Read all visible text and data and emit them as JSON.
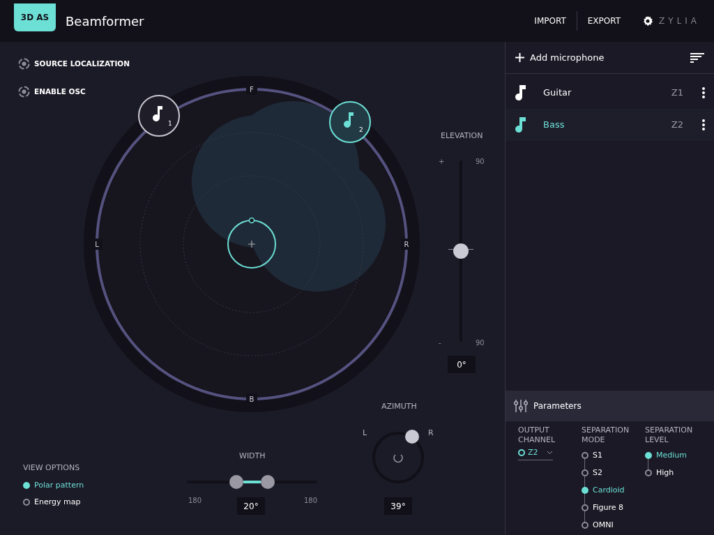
{
  "header": {
    "badge": "3D AS",
    "title": "Beamformer",
    "menu": [
      "IMPORT",
      "EXPORT"
    ],
    "logo": "ZYLIA"
  },
  "toggles": [
    {
      "label": "SOURCE LOCALIZATION"
    },
    {
      "label": "ENABLE OSC"
    }
  ],
  "sound_field": {
    "directions": [
      "F",
      "L",
      "R",
      "B"
    ],
    "sources": [
      {
        "number": "1",
        "selected": false
      },
      {
        "number": "2",
        "selected": true
      }
    ]
  },
  "elevation": {
    "title": "ELEVATION",
    "plus": "+",
    "minus": "-",
    "max": "90",
    "min": "90",
    "level": 0.5,
    "value": "0°"
  },
  "width": {
    "title": "WIDTH",
    "min": "180",
    "max": "180",
    "level": 0.13,
    "value": "20°"
  },
  "azimuth": {
    "title": "AZIMUTH",
    "left": "L",
    "right": "R",
    "value": "39°"
  },
  "view_options": {
    "title": "VIEW OPTIONS",
    "items": [
      {
        "label": "Polar pattern",
        "selected": true
      },
      {
        "label": "Energy map",
        "selected": false
      }
    ]
  },
  "microphones": {
    "add": "Add microphone",
    "items": [
      {
        "name": "Guitar",
        "channel": "Z1",
        "selected": false
      },
      {
        "name": "Bass",
        "channel": "Z2",
        "selected": true
      }
    ]
  },
  "parameters": {
    "title": "Parameters",
    "output_channel": {
      "label": "OUTPUT CHANNEL",
      "value": "Z2"
    },
    "separation_mode": {
      "label": "SEPARATION MODE",
      "options": [
        {
          "label": "S1",
          "selected": false
        },
        {
          "label": "S2",
          "selected": false
        },
        {
          "label": "Cardioid",
          "selected": true
        },
        {
          "label": "Figure 8",
          "selected": false
        },
        {
          "label": "OMNI",
          "selected": false
        }
      ]
    },
    "separation_level": {
      "label": "SEPARATION LEVEL",
      "options": [
        {
          "label": "Medium",
          "selected": true
        },
        {
          "label": "High",
          "selected": false
        }
      ]
    }
  }
}
